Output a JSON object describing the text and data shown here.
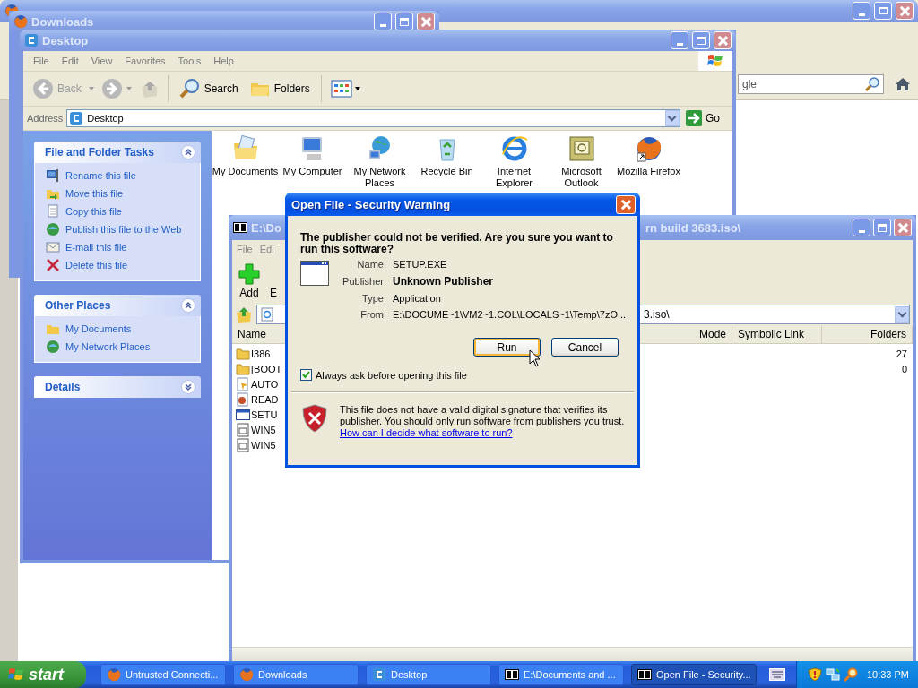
{
  "firefox_window": {
    "search_field": {
      "value": "gle"
    }
  },
  "downloads_window": {
    "title": "Downloads"
  },
  "explorer_window": {
    "title": "Desktop",
    "menu": [
      "File",
      "Edit",
      "View",
      "Favorites",
      "Tools",
      "Help"
    ],
    "toolbar": {
      "back": {
        "label": "Back",
        "disabled": true
      },
      "search": "Search",
      "folders": "Folders"
    },
    "address": {
      "label": "Address",
      "value": "Desktop",
      "go": "Go"
    },
    "task_panels": [
      {
        "title": "File and Folder Tasks",
        "expanded": true,
        "items": [
          {
            "label": "Rename this file",
            "kind": "rename"
          },
          {
            "label": "Move this file",
            "kind": "move"
          },
          {
            "label": "Copy this file",
            "kind": "copy"
          },
          {
            "label": "Publish this file to the Web",
            "kind": "publish"
          },
          {
            "label": "E-mail this file",
            "kind": "email"
          },
          {
            "label": "Delete this file",
            "kind": "delete"
          }
        ]
      },
      {
        "title": "Other Places",
        "expanded": true,
        "items": [
          {
            "label": "My Documents",
            "kind": "documents"
          },
          {
            "label": "My Network Places",
            "kind": "network"
          }
        ]
      },
      {
        "title": "Details",
        "expanded": false
      }
    ],
    "desktop_icons": [
      {
        "label": "My Documents",
        "kind": "documents"
      },
      {
        "label": "My Computer",
        "kind": "computer"
      },
      {
        "label": "My Network Places",
        "kind": "network"
      },
      {
        "label": "Recycle Bin",
        "kind": "recycle"
      },
      {
        "label": "Internet Explorer",
        "kind": "ie"
      },
      {
        "label": "Microsoft Outlook",
        "kind": "outlook"
      },
      {
        "label": "Mozilla Firefox",
        "kind": "firefox"
      }
    ]
  },
  "archive_window": {
    "title_start": "E:\\Do",
    "title_end": "rn build 3683.iso\\",
    "menu": [
      "File",
      "Edi"
    ],
    "toolbar": [
      "Add",
      "E"
    ],
    "path": "3.iso\\",
    "columns": [
      "Name",
      "Mode",
      "Symbolic Link",
      "Folders"
    ],
    "rows": [
      {
        "name": "I386",
        "kind": "folder",
        "folders": "27"
      },
      {
        "name": "[BOOT",
        "kind": "folder",
        "folders": "0"
      },
      {
        "name": "AUTO",
        "kind": "setup"
      },
      {
        "name": "READ",
        "kind": "html"
      },
      {
        "name": "SETU",
        "kind": "exe"
      },
      {
        "name": "WIN5",
        "kind": "text"
      },
      {
        "name": "WIN5",
        "kind": "text"
      }
    ]
  },
  "dialog": {
    "title": "Open File - Security Warning",
    "heading": "The publisher could not be verified.  Are you sure you want to run this software?",
    "fields": [
      {
        "label": "Name:",
        "value": "SETUP.EXE",
        "bold": false
      },
      {
        "label": "Publisher:",
        "value": "Unknown Publisher",
        "bold": true
      },
      {
        "label": "Type:",
        "value": "Application",
        "bold": false
      },
      {
        "label": "From:",
        "value": "E:\\DOCUME~1\\VM2~1.COL\\LOCALS~1\\Temp\\7zO...",
        "bold": false
      }
    ],
    "buttons": [
      {
        "label": "Run",
        "focused": true
      },
      {
        "label": "Cancel",
        "focused": false
      }
    ],
    "checkbox": {
      "label": "Always ask before opening this file",
      "checked": true
    },
    "warning": "This file does not have a valid digital signature that verifies its publisher.  You should only run software from publishers you trust.",
    "link": "How can I decide what software to run?"
  },
  "taskbar": {
    "start": "start",
    "tasks": [
      {
        "label": "Untrusted Connecti...",
        "kind": "firefox",
        "selected": false
      },
      {
        "label": "Downloads",
        "kind": "firefox",
        "selected": false
      },
      {
        "label": "Desktop",
        "kind": "explorer",
        "selected": false
      },
      {
        "label": "E:\\Documents and ...",
        "kind": "sevenzip",
        "selected": false
      },
      {
        "label": "Open File - Security...",
        "kind": "sevenzip",
        "selected": true
      }
    ],
    "clock": "10:33 PM"
  }
}
